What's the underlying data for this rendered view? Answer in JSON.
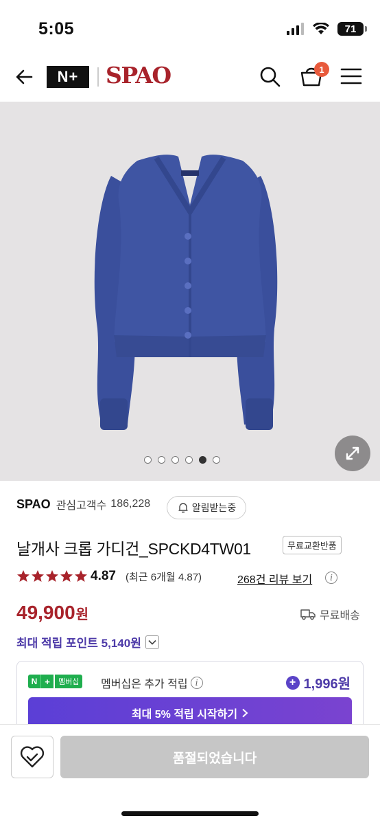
{
  "status_bar": {
    "time": "5:05",
    "battery": "71"
  },
  "header": {
    "logo_nplus": "N+",
    "logo_spao": "SPAO",
    "cart_count": "1"
  },
  "gallery": {
    "slide_count": 6,
    "active_index": 4
  },
  "product": {
    "brand": "SPAO",
    "wish_label": "관심고객수",
    "wish_count": "186,228",
    "alert_label": "알림받는중",
    "title": "날개사 크롭 가디건_SPCKD4TW01",
    "badge": "무료교환반품",
    "rating": "4.87",
    "rating_recent": "(최근 6개월 4.87)",
    "review_link": "268건 리뷰 보기",
    "price": "49,900",
    "price_unit": "원",
    "shipping": "무료배송",
    "points": "최대 적립 포인트 5,140원"
  },
  "membership": {
    "np_n": "N",
    "np_plus": "+",
    "np_label": "멤버십",
    "text": "멤버십은 추가 적립",
    "bonus": "1,996원",
    "cta": "최대 5% 적립 시작하기"
  },
  "bottom": {
    "soldout": "품절되었습니다"
  },
  "colors": {
    "brand": "#a8232b",
    "accent": "#4d3aa8",
    "nplus_green": "#1fae4e"
  }
}
